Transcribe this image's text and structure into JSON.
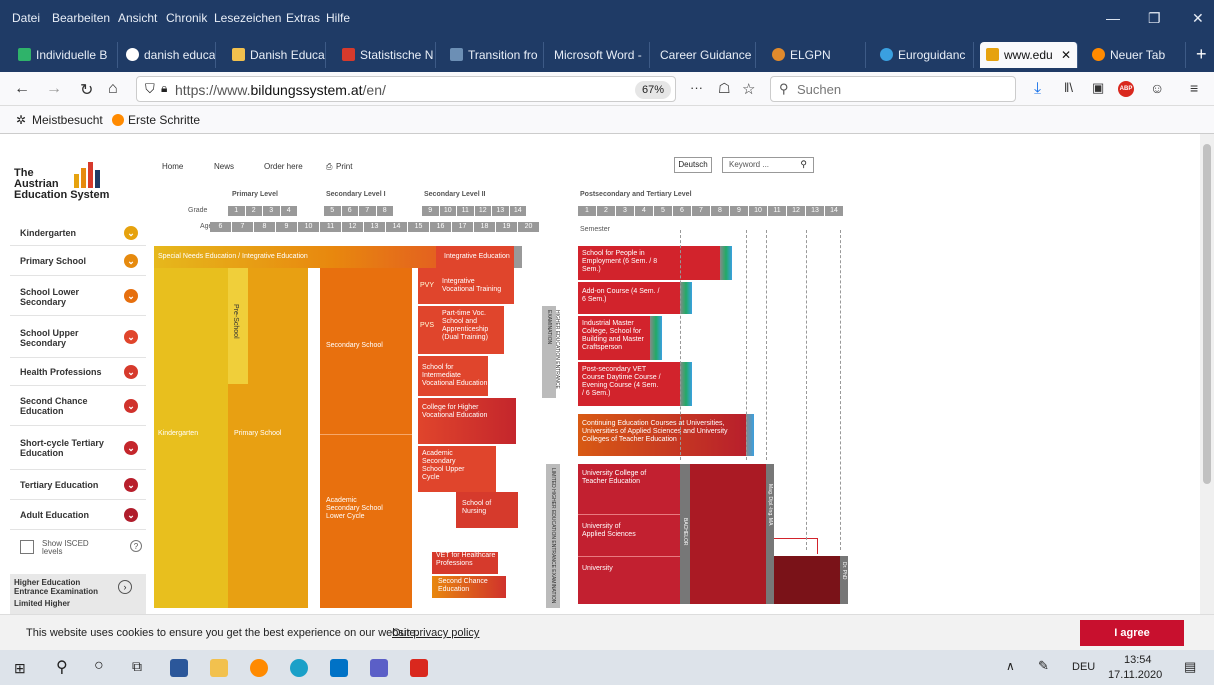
{
  "menu": [
    "Datei",
    "Bearbeiten",
    "Ansicht",
    "Chronik",
    "Lesezeichen",
    "Extras",
    "Hilfe"
  ],
  "window_controls": [
    "—",
    "❐",
    "✕"
  ],
  "tabs": [
    "Individuelle B",
    "danish educa",
    "Danish Educa",
    "Statistische N",
    "Transition fro",
    "Microsoft Word -",
    "Career Guidance",
    "ELGPN",
    "Euroguidanc",
    "www.edu",
    "Neuer Tab"
  ],
  "tab_close": "✕",
  "new_tab": "+",
  "url": {
    "host_pre": "https://www.",
    "host_bold": "bildungssystem.at",
    "path": "/en/"
  },
  "zoom": "67%",
  "more": "···",
  "search_placeholder": "Suchen",
  "bookmarks": [
    "Meistbesucht",
    "Erste Schritte"
  ],
  "site": {
    "logo": [
      "The",
      "Austrian",
      "Education System"
    ],
    "topnav": [
      "Home",
      "News",
      "Order here",
      "Print"
    ],
    "lang": "Deutsch",
    "keyword": "Keyword ...",
    "sidebar": [
      {
        "label": "Kindergarten",
        "color": "#e6a20e"
      },
      {
        "label": "Primary School",
        "color": "#e68a0e"
      },
      {
        "label": "School Lower Secondary",
        "color": "#e66f0e"
      },
      {
        "label": "School Upper Secondary",
        "color": "#e0452c"
      },
      {
        "label": "Health Professions",
        "color": "#d63a2c"
      },
      {
        "label": "Second Chance Education",
        "color": "#d0322c"
      },
      {
        "label": "Short-cycle Tertiary Education",
        "color": "#c4262c"
      },
      {
        "label": "Tertiary Education",
        "color": "#b81f2c"
      },
      {
        "label": "Adult Education",
        "color": "#b01d2c"
      }
    ],
    "isced": "Show ISCED levels",
    "help": "?",
    "higher_ed": "Higher Education Entrance Examination",
    "limited": "Limited Higher",
    "levels": [
      "Primary Level",
      "Secondary Level I",
      "Secondary Level II",
      "Postsecondary and Tertiary Level"
    ],
    "grade_label": "Grade",
    "age_label": "Age",
    "grades": [
      "1",
      "2",
      "3",
      "4",
      "5",
      "6",
      "7",
      "8",
      "9",
      "10",
      "11",
      "12",
      "13",
      "14"
    ],
    "ages": [
      "6",
      "7",
      "8",
      "9",
      "10",
      "11",
      "12",
      "13",
      "14",
      "15",
      "16",
      "17",
      "18",
      "19",
      "20"
    ],
    "semester_label": "Semester",
    "semesters": [
      "1",
      "2",
      "3",
      "4",
      "5",
      "6",
      "7",
      "8",
      "9",
      "10",
      "11",
      "12",
      "13",
      "14"
    ],
    "boxes": {
      "sne": "Special Needs Education / Integrative Education",
      "kg": "Kindergarten",
      "prim": "Primary School",
      "pre": "Pre-School",
      "sec": "Secondary School",
      "acad_lower": "Academic Secondary School Lower Cycle",
      "integ": "Integrative Education",
      "pvy": "PVY",
      "pvs": "PVS",
      "ivt": "Integrative Vocational Training",
      "part": "Part-time Voc. School and Apprenticeship (Dual Training)",
      "intermed": "School for Intermediate Vocational Education",
      "college": "College for Higher Vocational Education",
      "acad_upper": "Academic Secondary School Upper Cycle",
      "nursing": "School of Nursing",
      "vet": "VET for Healthcare Professions",
      "second": "Second Chance Education",
      "hee": "HIGHER EDUCATION ENTRANCE EXAMINATION",
      "lhee": "LIMITED HIGHER EDUCATION ENTRANCE EXAMINATION",
      "emp": "School for People in Employment (6 Sem. / 8 Sem.)",
      "addon": "Add-on Course (4 Sem. / 6 Sem.)",
      "master": "Industrial Master College, School for Building and Master Craftsperson",
      "postvet": "Post-secondary VET Course Daytime Course / Evening Course (4 Sem. / 6 Sem.)",
      "cont": "Continuing Education Courses at Universities, Universities of Applied Sciences and University Colleges of Teacher Education",
      "ucte": "University College of Teacher Education",
      "uas": "University of Applied Sciences",
      "uni": "University",
      "bachelor": "BACHELOR",
      "master_v": "Mag. Dipl.-Ing. MA",
      "phd": "Dr. PhD"
    }
  },
  "cookie": {
    "text": "This website uses cookies to ensure you get the best experience on our website.",
    "link": "Our privacy policy",
    "button": "I agree"
  },
  "tray": {
    "lang": "DEU",
    "time": "13:54",
    "date": "17.11.2020"
  }
}
